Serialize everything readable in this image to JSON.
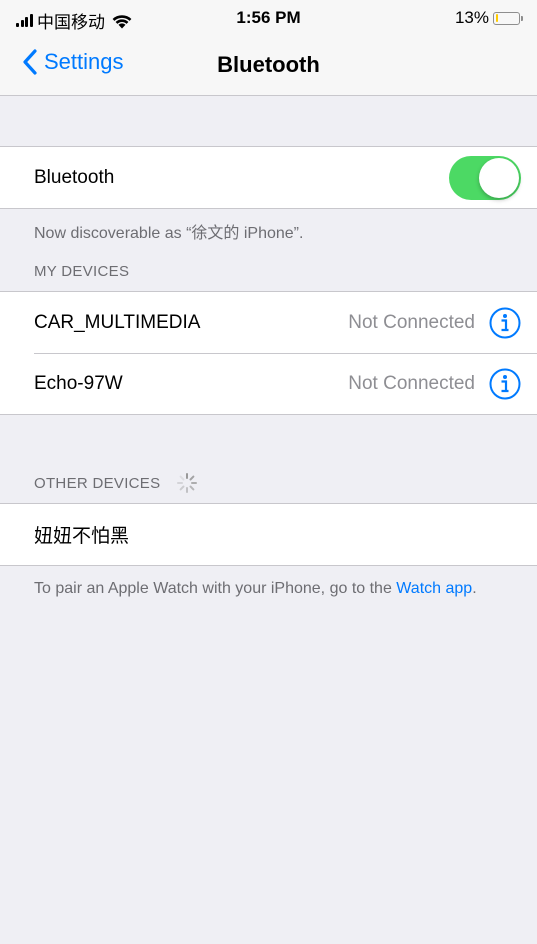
{
  "status_bar": {
    "carrier": "中国移动",
    "time": "1:56 PM",
    "battery_percent": "13%",
    "battery_level": 0.13,
    "battery_color": "#ffcc00"
  },
  "nav": {
    "back_label": "Settings",
    "title": "Bluetooth"
  },
  "bluetooth": {
    "label": "Bluetooth",
    "enabled": true,
    "toggle_color": "#4cd964",
    "discoverable_note": "Now discoverable as “徐文的 iPhone”."
  },
  "my_devices": {
    "header": "MY DEVICES",
    "items": [
      {
        "name": "CAR_MULTIMEDIA",
        "status": "Not Connected",
        "icon": "info-icon"
      },
      {
        "name": "Echo-97W",
        "status": "Not Connected",
        "icon": "info-icon"
      }
    ]
  },
  "other_devices": {
    "header": "OTHER DEVICES",
    "icon": "loading-spinner-icon",
    "items": [
      {
        "name": "妞妞不怕黑"
      }
    ]
  },
  "footer": {
    "text": "To pair an Apple Watch with your iPhone, go to the ",
    "link_text": "Watch app",
    "trailing": "."
  },
  "colors": {
    "accent": "#007aff",
    "background": "#efeff4",
    "secondary_text": "#8e8e93"
  }
}
